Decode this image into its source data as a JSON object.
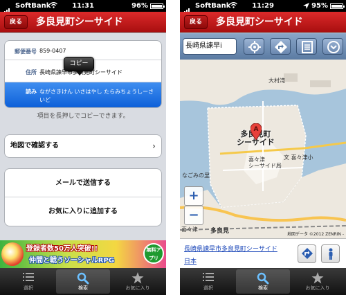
{
  "status_left": {
    "carrier": "SoftBank",
    "time": "11:31",
    "battery": "96%"
  },
  "status_right": {
    "carrier": "SoftBank",
    "time": "11:29",
    "battery": "95%"
  },
  "nav": {
    "back": "戻る",
    "title": "多良見町シーサイド"
  },
  "detail": {
    "zip_label": "郵便番号",
    "zip_value": "859-0407",
    "address_label": "住所",
    "address_value": "長崎県諫早市多良見町シーサイド",
    "reading_label": "読み",
    "reading_value": "ながさきけん いさはやし たらみちょうしーさいど",
    "copy_popup": "コピー",
    "hint": "項目を長押しでコピーできます。",
    "map_check": "地図で確認する",
    "send_mail": "メールで送信する",
    "add_favorite": "お気に入りに追加する"
  },
  "banner": {
    "line1": "登録者数50万人突破!!",
    "line2": "仲間と戦うソーシャルRPG",
    "badge": "無料アプリ"
  },
  "tabs": [
    {
      "label": "選択",
      "icon": "list-icon"
    },
    {
      "label": "検索",
      "icon": "search-icon"
    },
    {
      "label": "お気に入り",
      "icon": "star-icon"
    }
  ],
  "map": {
    "search_value": "長崎県諫早i",
    "place_name": "多良見町\nシーサイド",
    "labels": {
      "omura_bay": "大村湾",
      "kikitsu_sho": "文 喜々津小",
      "seaside_office": "喜々津\nシーサイド局",
      "tarami_town": "多良見",
      "izumi_sato": "なごみの里",
      "kikitsu": "喜々津"
    },
    "zoom_in": "+",
    "zoom_out": "−",
    "credit": "地図データ ©2012 ZENRIN -",
    "result_title": "長崎県諫早市多良見町シーサイド",
    "result_country": "日本"
  }
}
